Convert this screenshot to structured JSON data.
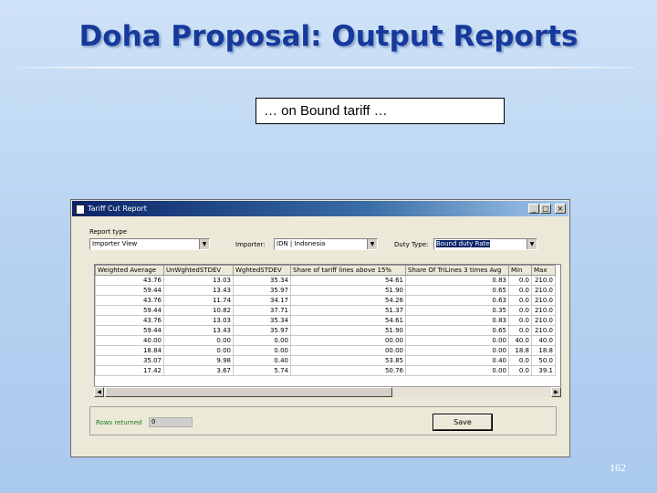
{
  "slide": {
    "title": "Doha Proposal: Output Reports",
    "caption": "… on Bound tariff …",
    "page_number": "162"
  },
  "window": {
    "title": "Tariff Cut Report",
    "controls": {
      "minimize": "_",
      "maximize": "□",
      "close": "×"
    },
    "report_type_label": "Report type",
    "report_type_value": "Importer View",
    "importer_label": "Importer:",
    "importer_value": "IDN | Indonesia",
    "duty_type_label": "Duty Type:",
    "duty_type_value": "Bound duty Rate",
    "table": {
      "columns": [
        "Weighted Average",
        "UnWghtedSTDEV",
        "WghtedSTDEV",
        "Share of tariff lines above 15%",
        "Share Of TriLines 3 times Avg",
        "Min",
        "Max"
      ],
      "rows": [
        [
          "43.76",
          "13.03",
          "35.34",
          "54.61",
          "0.83",
          "0.0",
          "210.0"
        ],
        [
          "59.44",
          "13.43",
          "35.97",
          "51.90",
          "0.65",
          "0.0",
          "210.0"
        ],
        [
          "43.76",
          "11.74",
          "34.17",
          "54.26",
          "0.63",
          "0.0",
          "210.0"
        ],
        [
          "59.44",
          "10.82",
          "37.71",
          "51.37",
          "0.35",
          "0.0",
          "210.0"
        ],
        [
          "43.76",
          "13.03",
          "35.34",
          "54.61",
          "0.83",
          "0.0",
          "210.0"
        ],
        [
          "59.44",
          "13.43",
          "35.97",
          "51.90",
          "0.65",
          "0.0",
          "210.0"
        ],
        [
          "40.00",
          "0.00",
          "0.00",
          "00.00",
          "0.00",
          "40.0",
          "40.0"
        ],
        [
          "18.84",
          "0.00",
          "0.00",
          "00.00",
          "0.00",
          "18.8",
          "18.8"
        ],
        [
          "35.07",
          "9.98",
          "0.40",
          "53.85",
          "0.40",
          "0.0",
          "50.0"
        ],
        [
          "17.42",
          "3.67",
          "5.74",
          "50.76",
          "0.00",
          "0.0",
          "39.1"
        ]
      ]
    },
    "rows_returned_label": "Rows returned",
    "rows_returned_value": "0",
    "save_label": "Save"
  }
}
